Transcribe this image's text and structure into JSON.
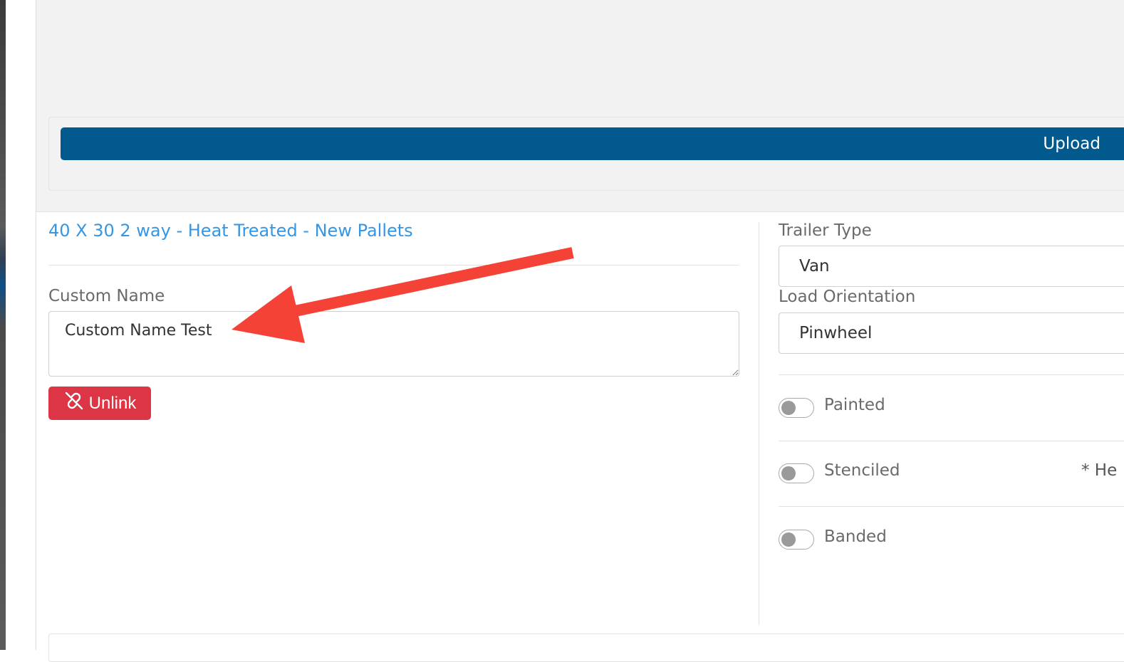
{
  "upload": {
    "label": "Upload"
  },
  "product": {
    "title": "40 X 30 2 way - Heat Treated - New Pallets"
  },
  "custom_name": {
    "label": "Custom Name",
    "value": "Custom Name Test"
  },
  "unlink": {
    "label": "Unlink",
    "icon": "unlink-icon",
    "color": "#dc3545"
  },
  "trailer_type": {
    "label": "Trailer Type",
    "value": "Van"
  },
  "load_orientation": {
    "label": "Load Orientation",
    "value": "Pinwheel"
  },
  "toggles": [
    {
      "label": "Painted",
      "on": false
    },
    {
      "label": "Stenciled",
      "on": false
    },
    {
      "label": "Banded",
      "on": false
    }
  ],
  "note": {
    "text": "* He"
  },
  "colors": {
    "primary": "#01598e",
    "link": "#3496e4",
    "danger": "#dc3545",
    "annotation_arrow": "#f44336"
  }
}
